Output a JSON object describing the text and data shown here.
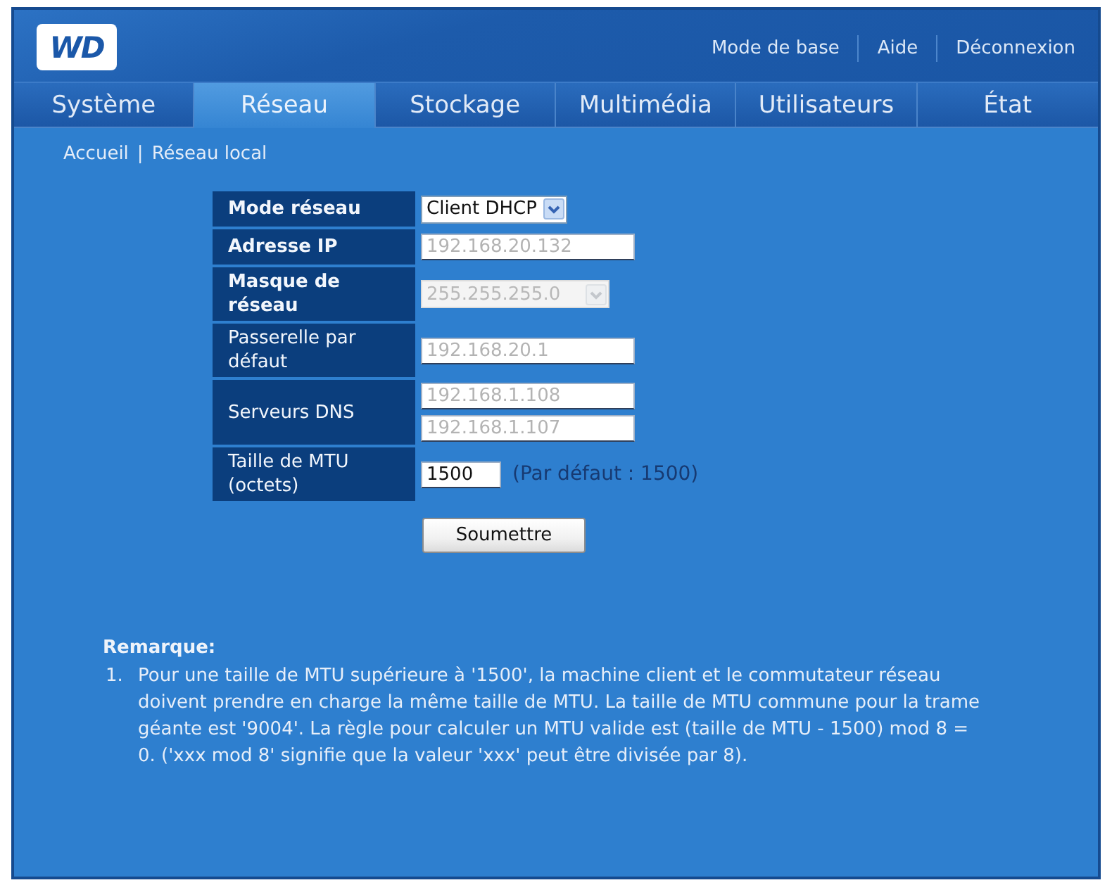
{
  "header": {
    "logo": "WD",
    "links": [
      {
        "label": "Mode de base"
      },
      {
        "label": "Aide"
      },
      {
        "label": "Déconnexion"
      }
    ]
  },
  "tabs": [
    {
      "label": "Système",
      "selected": false
    },
    {
      "label": "Réseau",
      "selected": true
    },
    {
      "label": "Stockage",
      "selected": false
    },
    {
      "label": "Multimédia",
      "selected": false
    },
    {
      "label": "Utilisateurs",
      "selected": false
    },
    {
      "label": "État",
      "selected": false
    }
  ],
  "breadcrumb": {
    "items": [
      "Accueil",
      "Réseau local"
    ],
    "separator": "|"
  },
  "form": {
    "rows": [
      {
        "label": "Mode réseau",
        "bold": true,
        "fields": [
          {
            "kind": "select",
            "value": "Client DHCP",
            "disabled": false
          }
        ]
      },
      {
        "label": "Adresse IP",
        "bold": true,
        "fields": [
          {
            "kind": "text",
            "value": "192.168.20.132",
            "disabled": true
          }
        ]
      },
      {
        "label": "Masque de réseau",
        "bold": true,
        "fields": [
          {
            "kind": "select",
            "value": "255.255.255.0",
            "disabled": true
          }
        ]
      },
      {
        "label": "Passerelle par défaut",
        "bold": false,
        "fields": [
          {
            "kind": "text",
            "value": "192.168.20.1",
            "disabled": true
          }
        ]
      },
      {
        "label": "Serveurs DNS",
        "bold": false,
        "fields": [
          {
            "kind": "text",
            "value": "192.168.1.108",
            "disabled": true
          },
          {
            "kind": "text",
            "value": "192.168.1.107",
            "disabled": true
          }
        ]
      },
      {
        "label": "Taille de MTU (octets)",
        "bold": false,
        "fields": [
          {
            "kind": "number",
            "value": "1500",
            "disabled": false,
            "hint": "(Par défaut : 1500)"
          }
        ]
      }
    ],
    "submit": "Soumettre"
  },
  "note": {
    "title": "Remarque:",
    "items": [
      {
        "number": "1.",
        "text": "Pour une taille de MTU supérieure à '1500', la machine client et le commutateur réseau doivent prendre en charge la même taille de MTU. La taille de MTU commune pour la trame géante est '9004'. La règle pour calculer un MTU valide est (taille de MTU - 1500) mod 8 = 0. ('xxx mod 8' signifie que la valeur 'xxx' peut être divisée par 8)."
      }
    ]
  }
}
